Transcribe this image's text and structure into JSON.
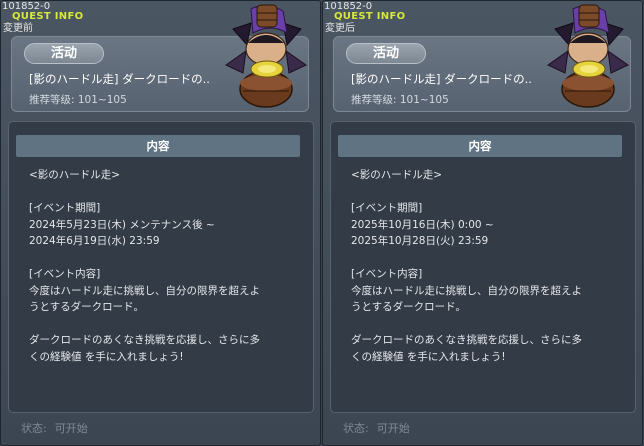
{
  "panels": [
    {
      "id_text": "101852-0",
      "header": "QUEST INFO",
      "state_label": "変更前",
      "tag": "活动",
      "title": "[影のハードル走] ダークロードの..",
      "level": "推荐等级:  101~105",
      "content_header": "内容",
      "content_lines": [
        "<影のハードル走>",
        "",
        "[イベント期間]",
        "2024年5月23日(木) メンテナンス後 ~",
        "2024年6月19日(水) 23:59",
        "",
        "[イベント内容]",
        "今度はハードル走に挑戦し、自分の限界を超えよ",
        "うとするダークロード。",
        "",
        "ダークロードのあくなき挑戦を応援し、さらに多",
        "くの経験値 を手に入れましょう!"
      ],
      "status_label": "状态:",
      "status_value": "可开始"
    },
    {
      "id_text": "101852-0",
      "header": "QUEST INFO",
      "state_label": "変更后",
      "tag": "活动",
      "title": "[影のハードル走] ダークロードの..",
      "level": "推荐等级:  101~105",
      "content_header": "内容",
      "content_lines": [
        "<影のハードル走>",
        "",
        "[イベント期間]",
        "2025年10月16日(木) 0:00 ~",
        "2025年10月28日(火) 23:59",
        "",
        "[イベント内容]",
        "今度はハードル走に挑戦し、自分の限界を超えよ",
        "うとするダークロード。",
        "",
        "ダークロードのあくなき挑戦を応援し、さらに多",
        "くの経験値 を手に入れましょう!"
      ],
      "status_label": "状态:",
      "status_value": "可开始"
    }
  ],
  "colors": {
    "header_yellow": "#d7e83a",
    "panel_bg": "#4b5663",
    "content_bg": "#333b47",
    "content_header_bg": "#5f7382"
  },
  "icons": {
    "npc": "dark-lord-npc-icon"
  }
}
